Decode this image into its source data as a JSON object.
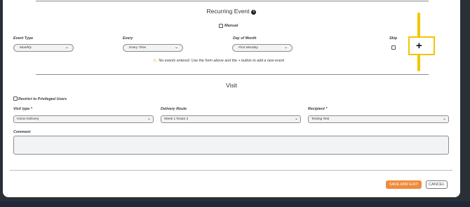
{
  "recurring": {
    "title": "Recurring Event",
    "manual_label": "Manual",
    "event_type_label": "Event Type",
    "event_type_value": "Monthly",
    "every_label": "Every",
    "every_value": "Every Time",
    "day_of_month_label": "Day of Month",
    "day_of_month_value": "First Monday",
    "skip_label": "Skip",
    "add_button_symbol": "+",
    "no_events_message": "No events entered. Use the form above and the + button to add a new event"
  },
  "visit": {
    "title": "Visit",
    "restrict_label": "Restrict to Privileged Users",
    "visit_type_label": "Visit type *",
    "visit_type_value": "Home Delivery",
    "delivery_route_label": "Delivery Route",
    "delivery_route_value": "Week 1 Route 2",
    "recipient_label": "Recipient *",
    "recipient_value": "Testing Test",
    "comment_label": "Comment",
    "comment_value": ""
  },
  "footer": {
    "save_label": "SAVE AND EXIT",
    "cancel_label": "CANCEL"
  },
  "colors": {
    "accent_orange": "#f08a3c",
    "annotation_yellow": "#f2c500"
  },
  "icons": {
    "info": "info-icon",
    "warning": "warning-icon",
    "chevron": "chevron-down-icon",
    "plus": "plus-icon"
  }
}
